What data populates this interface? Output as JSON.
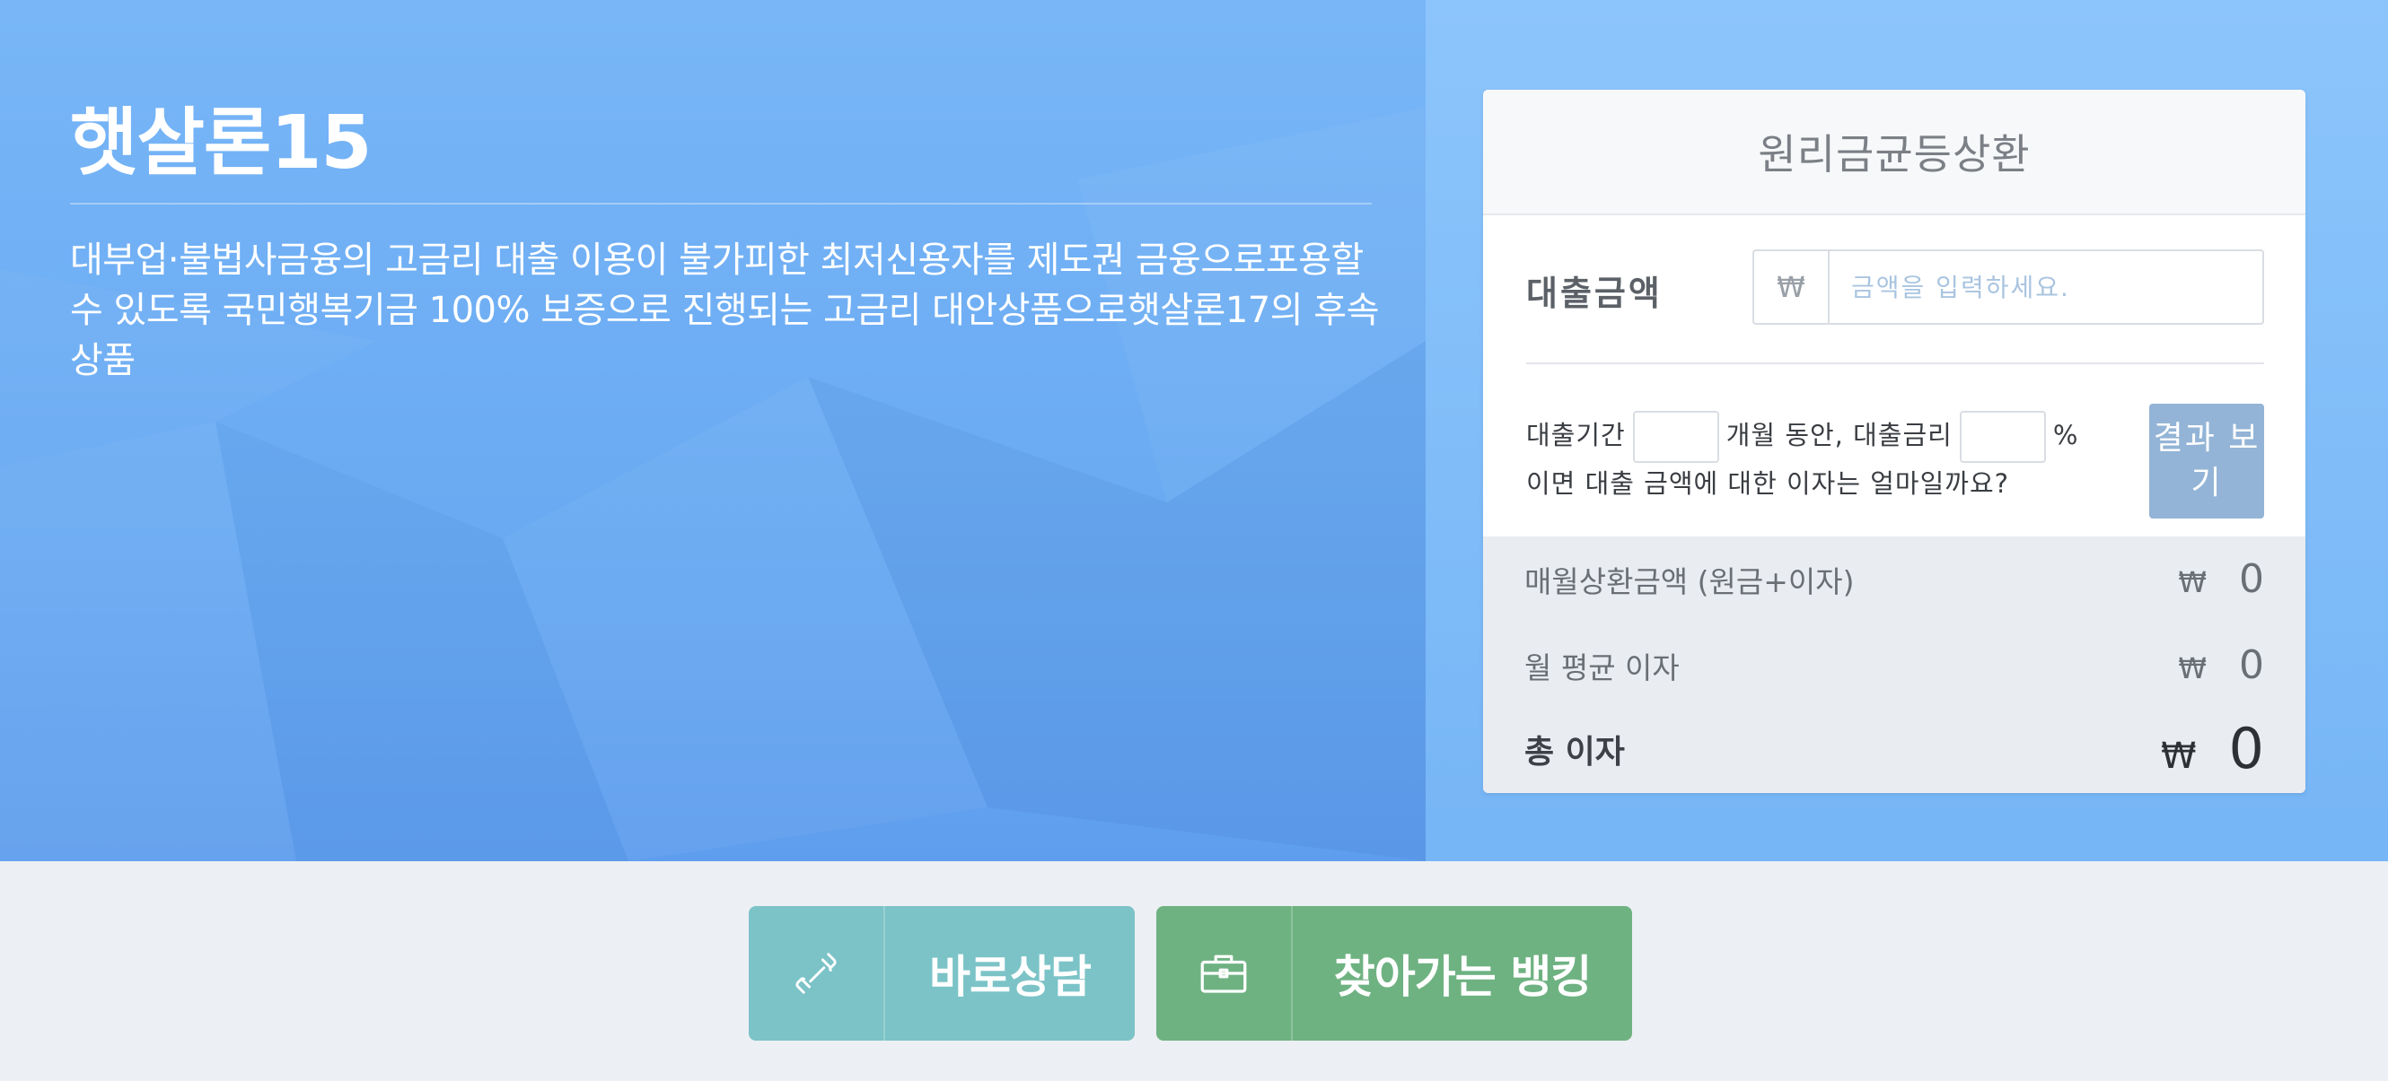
{
  "product": {
    "title": "햇살론15",
    "description": "대부업·불법사금융의 고금리 대출 이용이 불가피한 최저신용자를 제도권 금융으로포용할 수 있도록 국민행복기금 100% 보증으로 진행되는 고금리 대안상품으로햇살론17의 후속상품"
  },
  "calculator": {
    "header": "원리금균등상환",
    "amount_label": "대출금액",
    "currency_symbol": "₩",
    "amount_placeholder": "금액을 입력하세요.",
    "amount_value": "",
    "cond_period_label": "대출기간",
    "cond_months_label": "개월 동안, 대출금리",
    "cond_percent_label": "%",
    "cond_line2": "이면 대출 금액에 대한 이자는 얼마일까요?",
    "period_value": "",
    "rate_value": "",
    "result_button": "결과 보기",
    "results": {
      "monthly_label": "매월상환금액 (원금+이자)",
      "monthly_value": "0",
      "avg_interest_label": "월 평균 이자",
      "avg_interest_value": "0",
      "total_interest_label": "총 이자",
      "total_interest_value": "0"
    }
  },
  "actions": {
    "consult_label": "바로상담",
    "consult_icon": "phone-icon",
    "banking_label": "찾아가는 뱅킹",
    "banking_icon": "briefcase-icon"
  },
  "colors": {
    "hero_blue": "#6aaaf2",
    "consult_button": "#7bc3c7",
    "banking_button": "#6fb282",
    "result_button": "#93b4d6"
  }
}
